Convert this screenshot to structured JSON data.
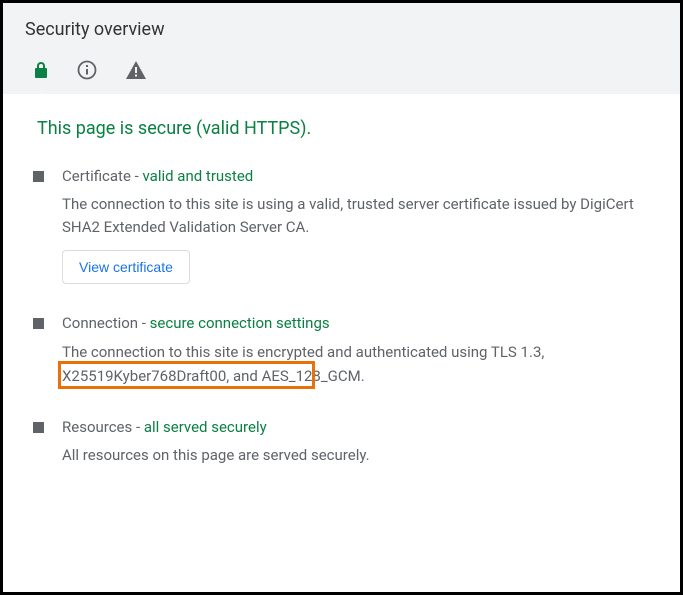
{
  "header": {
    "title": "Security overview"
  },
  "main": {
    "secure_heading": "This page is secure (valid HTTPS)."
  },
  "certificate": {
    "label": "Certificate - ",
    "status": "valid and trusted",
    "description": "The connection to this site is using a valid, trusted server certificate issued by DigiCert SHA2 Extended Validation Server CA.",
    "button_label": "View certificate"
  },
  "connection": {
    "label": "Connection - ",
    "status": "secure connection settings",
    "description": "The connection to this site is encrypted and authenticated using TLS 1.3, X25519Kyber768Draft00, and AES_128_GCM.",
    "highlighted_term": "X25519Kyber768Draft00"
  },
  "resources": {
    "label": "Resources - ",
    "status": "all served securely",
    "description": "All resources on this page are served securely."
  }
}
